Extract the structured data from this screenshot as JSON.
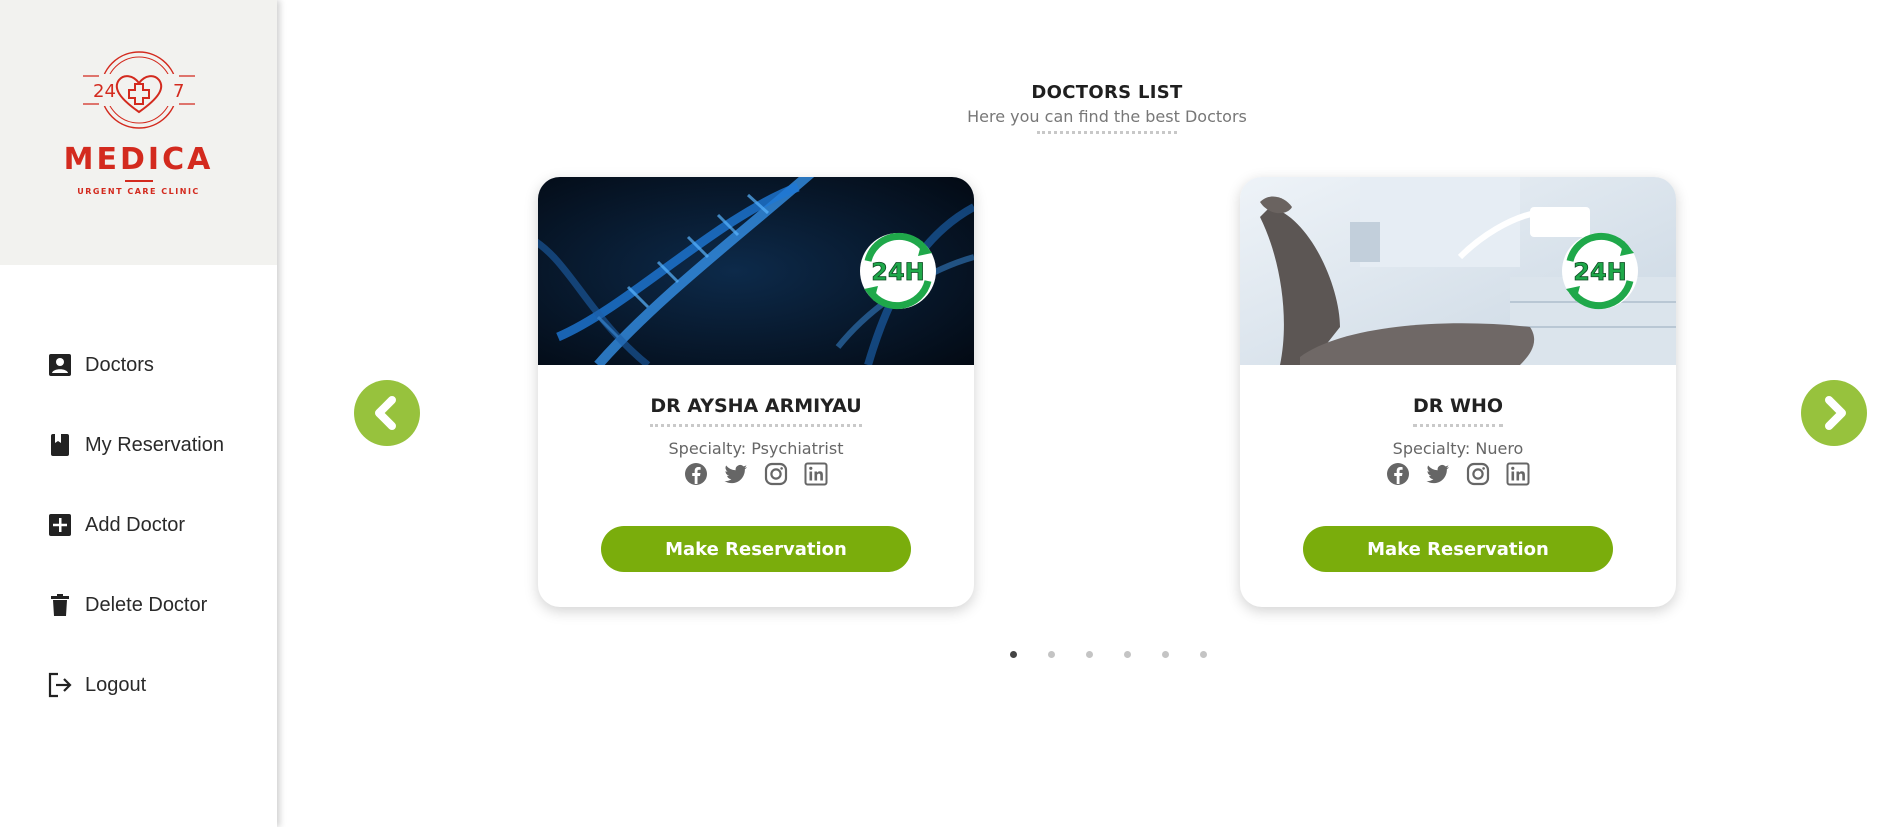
{
  "brand": {
    "hours_left": "24",
    "hours_right": "7",
    "name": "MEDICA",
    "tagline": "URGENT CARE CLINIC",
    "color": "#d32a1e"
  },
  "sidebar": {
    "items": [
      {
        "label": "Doctors",
        "icon": "person-badge-icon"
      },
      {
        "label": "My Reservation",
        "icon": "bookmark-book-icon"
      },
      {
        "label": "Add Doctor",
        "icon": "plus-square-icon"
      },
      {
        "label": "Delete Doctor",
        "icon": "trash-icon"
      },
      {
        "label": "Logout",
        "icon": "logout-icon"
      }
    ]
  },
  "main": {
    "title": "DOCTORS LIST",
    "subtitle": "Here you can find the best Doctors",
    "accent_color": "#97c23d",
    "button_color": "#7aad0c",
    "cards": [
      {
        "name": "DR AYSHA ARMIYAU",
        "specialty": "Specialty: Psychiatrist",
        "badge": "24H",
        "image": "dna-helix-image",
        "button": "Make Reservation"
      },
      {
        "name": "DR WHO",
        "specialty": "Specialty: Nuero",
        "badge": "24H",
        "image": "dental-chair-image",
        "button": "Make Reservation"
      }
    ],
    "socials": [
      "facebook-icon",
      "twitter-icon",
      "instagram-icon",
      "linkedin-icon"
    ],
    "carousel": {
      "pages": 6,
      "active": 1
    }
  }
}
